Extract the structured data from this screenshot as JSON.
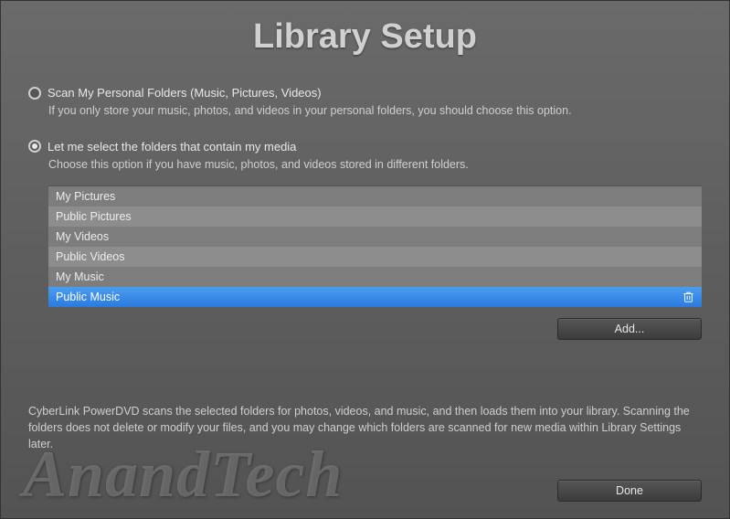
{
  "title": "Library Setup",
  "options": {
    "personal": {
      "label": "Scan My Personal Folders (Music, Pictures, Videos)",
      "desc": "If you only store your music, photos, and videos in your personal folders, you should choose this option.",
      "selected": false
    },
    "custom": {
      "label": "Let me select the folders that contain my media",
      "desc": "Choose this option if you have music, photos, and videos stored in different folders.",
      "selected": true
    }
  },
  "folders": [
    {
      "name": "My Pictures",
      "selected": false
    },
    {
      "name": "Public Pictures",
      "selected": false
    },
    {
      "name": "My Videos",
      "selected": false
    },
    {
      "name": "Public Videos",
      "selected": false
    },
    {
      "name": "My Music",
      "selected": false
    },
    {
      "name": "Public Music",
      "selected": true
    }
  ],
  "buttons": {
    "add": "Add...",
    "done": "Done"
  },
  "footer": "CyberLink PowerDVD scans the selected folders for photos, videos, and music, and then loads them into your library. Scanning the folders does not delete or modify your files, and you may change which folders are scanned for new media within Library Settings later.",
  "watermark": "AnandTech"
}
